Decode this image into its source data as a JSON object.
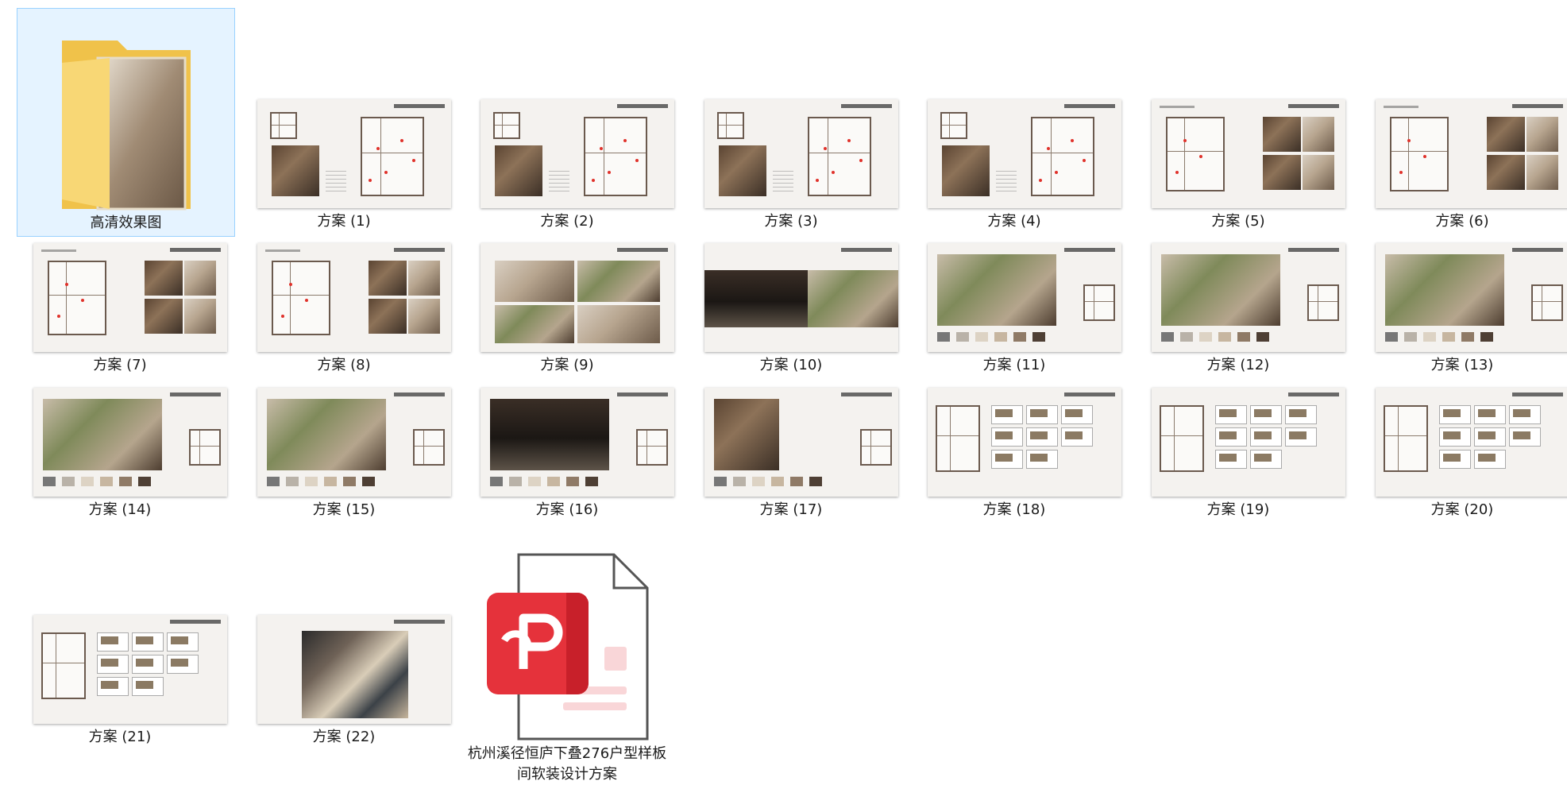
{
  "items": [
    {
      "label": "高清效果图",
      "type": "folder",
      "selected": true
    },
    {
      "label": "方案 (1)",
      "type": "plan-photo"
    },
    {
      "label": "方案 (2)",
      "type": "plan-photo"
    },
    {
      "label": "方案 (3)",
      "type": "plan-photo"
    },
    {
      "label": "方案 (4)",
      "type": "plan-photo"
    },
    {
      "label": "方案 (5)",
      "type": "plan-photos"
    },
    {
      "label": "方案 (6)",
      "type": "plan-photos"
    },
    {
      "label": "方案 (7)",
      "type": "plan-photos"
    },
    {
      "label": "方案 (8)",
      "type": "plan-photos"
    },
    {
      "label": "方案 (9)",
      "type": "collage"
    },
    {
      "label": "方案 (10)",
      "type": "garage-wide"
    },
    {
      "label": "方案 (11)",
      "type": "render-swatch"
    },
    {
      "label": "方案 (12)",
      "type": "render-swatch"
    },
    {
      "label": "方案 (13)",
      "type": "render-swatch"
    },
    {
      "label": "方案 (14)",
      "type": "render-swatch"
    },
    {
      "label": "方案 (15)",
      "type": "render-swatch"
    },
    {
      "label": "方案 (16)",
      "type": "garage-swatch"
    },
    {
      "label": "方案 (17)",
      "type": "elevator"
    },
    {
      "label": "方案 (18)",
      "type": "furniture-list"
    },
    {
      "label": "方案 (19)",
      "type": "furniture-list"
    },
    {
      "label": "方案 (20)",
      "type": "furniture-list"
    },
    {
      "label": "方案 (21)",
      "type": "furniture-list"
    },
    {
      "label": "方案 (22)",
      "type": "material"
    },
    {
      "label": "杭州溪径恒庐下叠276户型样板间软装设计方案",
      "type": "pdf"
    }
  ],
  "icons": {
    "folder": "folder-icon",
    "pdf": "pdf-icon"
  },
  "colors": {
    "selection_bg": "#e5f3ff",
    "selection_border": "#99d1ff",
    "pdf_red": "#e5323b",
    "folder_yellow": "#f8d775"
  }
}
